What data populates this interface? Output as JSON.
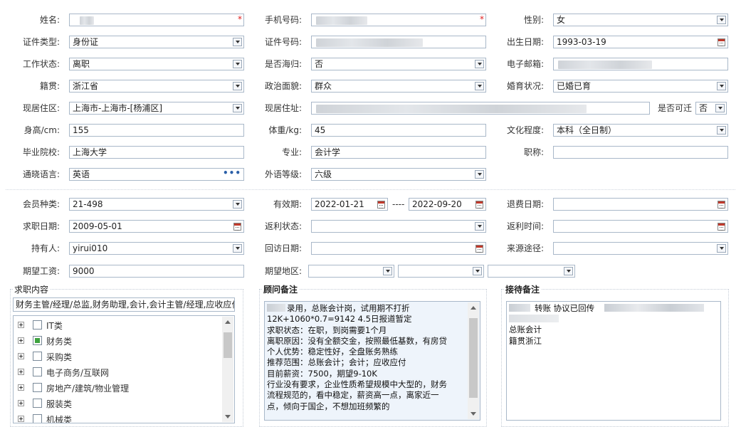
{
  "row1": {
    "name_label": "姓名:",
    "phone_label": "手机号码:",
    "gender_label": "性别:",
    "gender_value": "女",
    "required_mark": "*"
  },
  "row2": {
    "idtype_label": "证件类型:",
    "idtype_value": "身份证",
    "idno_label": "证件号码:",
    "birth_label": "出生日期:",
    "birth_value": "1993-03-19"
  },
  "row3": {
    "work_label": "工作状态:",
    "work_value": "离职",
    "overseas_label": "是否海归:",
    "overseas_value": "否",
    "email_label": "电子邮箱:"
  },
  "row4": {
    "origin_label": "籍贯:",
    "origin_value": "浙江省",
    "politics_label": "政治面貌:",
    "politics_value": "群众",
    "marital_label": "婚育状况:",
    "marital_value": "已婚已育"
  },
  "row5": {
    "residence_label": "现居住区:",
    "residence_value": "上海市-上海市-[杨浦区]",
    "address_label": "现居住址:",
    "relocate_label": "是否可迁",
    "relocate_value": "否"
  },
  "row6": {
    "height_label": "身高/cm:",
    "height_value": "155",
    "weight_label": "体重/kg:",
    "weight_value": "45",
    "edu_label": "文化程度:",
    "edu_value": "本科（全日制）"
  },
  "row7": {
    "school_label": "毕业院校:",
    "school_value": "上海大学",
    "major_label": "专业:",
    "major_value": "会计学",
    "title_label": "职称:"
  },
  "row8": {
    "lang_label": "通晓语言:",
    "lang_value": "英语",
    "more_glyph": "•••",
    "langlevel_label": "外语等级:",
    "langlevel_value": "六级"
  },
  "row9": {
    "member_label": "会员种类:",
    "member_value": "21-498",
    "valid_label": "有效期:",
    "valid_from": "2022-01-21",
    "valid_sep": "----",
    "valid_to": "2022-09-20",
    "refund_label": "退费日期:"
  },
  "row10": {
    "jobdate_label": "求职日期:",
    "jobdate_value": "2009-05-01",
    "rebate_state_label": "返利状态:",
    "rebate_time_label": "返利时间:"
  },
  "row11": {
    "holder_label": "持有人:",
    "holder_value": "yirui010",
    "visit_label": "回访日期:",
    "source_label": "来源途径:"
  },
  "row12": {
    "salary_label": "期望工资:",
    "salary_value": "9000",
    "area_label": "期望地区:"
  },
  "job": {
    "legend": "求职内容",
    "summary": "财务主管/经理/总监,财务助理,会计,会计主管/经理,应收应付",
    "tree": [
      {
        "label": "IT类",
        "checked": false
      },
      {
        "label": "财务类",
        "checked": true
      },
      {
        "label": "采购类",
        "checked": false
      },
      {
        "label": "电子商务/互联网",
        "checked": false
      },
      {
        "label": "房地产/建筑/物业管理",
        "checked": false
      },
      {
        "label": "服装类",
        "checked": false
      },
      {
        "label": "机械类",
        "checked": false
      }
    ]
  },
  "advisor": {
    "legend": "顾问备注",
    "lines": [
      "录用，总账会计岗，试用期不打折",
      "12K+1060*0.7=9142  4.5日报道暂定",
      "求职状态：在职，到岗需要1个月",
      "离职原因：没有全额交金，按照最低基数，有房贷",
      "个人优势：稳定性好，全盘账务熟练",
      "推荐范围：总账会计；会计；应收应付",
      "目前薪资：7500，期望9-10K",
      "行业没有要求，企业性质希望规模中大型的，财务",
      "流程规范的，看中稳定，薪资高一点，离家近一",
      "点，倾向于国企，不想加班频繁的"
    ]
  },
  "receive": {
    "legend": "接待备注",
    "lines": [
      "转账  协议已回传",
      "总账会计",
      "籍贯浙江"
    ]
  },
  "colors": {
    "border": "#a9b8c9",
    "memo_bg": "#eef4fb",
    "checked": "#3fa33f",
    "required": "#e02020"
  }
}
